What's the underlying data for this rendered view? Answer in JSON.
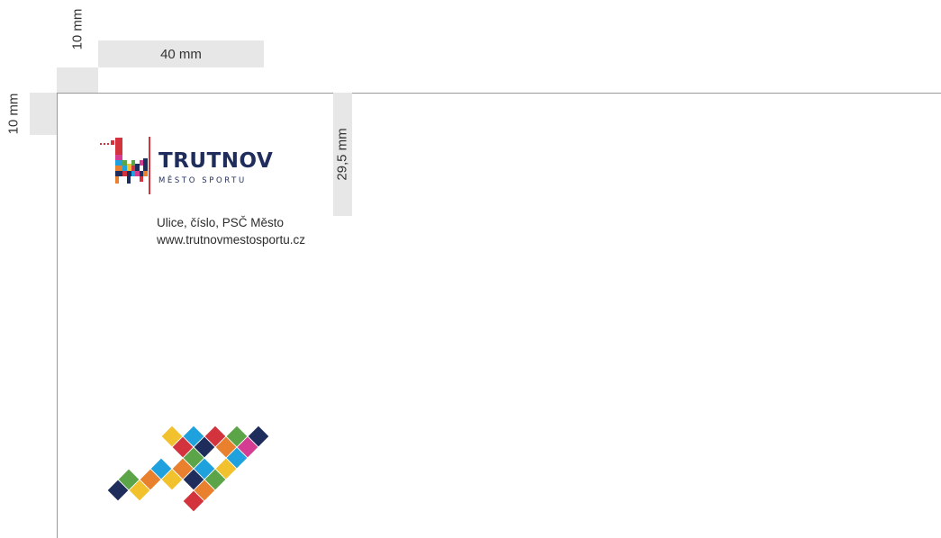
{
  "dimensions": {
    "top_margin": "10 mm",
    "left_margin": "10 mm",
    "logo_offset": "40 mm",
    "logo_height": "29,5 mm"
  },
  "logo": {
    "title": "TRUTNOV",
    "subtitle": "MĚSTO SPORTU",
    "colors": {
      "navy": "#1f2d5c",
      "red": "#d2333c",
      "pink": "#d43d92",
      "blue": "#1ea1dc",
      "green": "#5ba548",
      "orange": "#e8802e",
      "yellow": "#f2c22e"
    }
  },
  "address": {
    "line1": "Ulice, číslo, PSČ Město",
    "line2": "www.trutnovmestosportu.cz"
  }
}
